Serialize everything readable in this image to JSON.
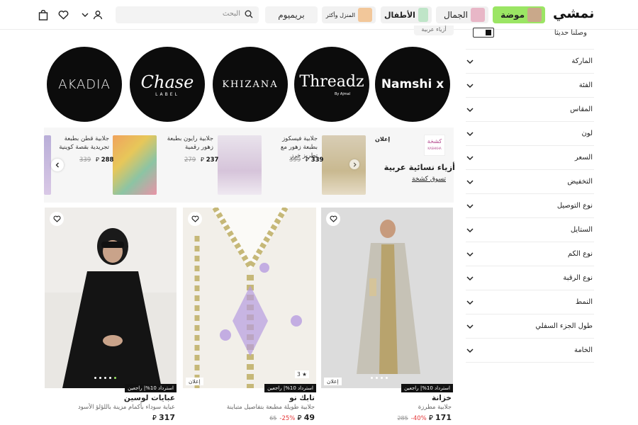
{
  "header": {
    "logo": "نمشي",
    "categories": [
      {
        "label": "موضة",
        "bg": "#9be564"
      },
      {
        "label": "الجمال",
        "bg": "#f1f1f1"
      },
      {
        "label": "الأطفال",
        "bg": "#f1f1f1"
      },
      {
        "label": "المنزل وأكثر",
        "bg": "#f1f1f1"
      }
    ],
    "premium": "بريميوم",
    "search_placeholder": "البحث"
  },
  "breadcrumb": "أزياء عربية",
  "sidebar": {
    "new_arrivals": "وصلنا حديثا",
    "filters": [
      "الماركة",
      "الفئة",
      "المقاس",
      "لون",
      "السعر",
      "التخفيض",
      "نوع التوصيل",
      "الستايل",
      "نوع الكم",
      "نوع الرقبة",
      "النمط",
      "طول الجزء السفلي",
      "الخامة"
    ]
  },
  "brands": [
    {
      "name": "Namshi x",
      "sub": ""
    },
    {
      "name": "Threadz",
      "sub": "By Ajmal"
    },
    {
      "name": "KHIZANA",
      "sub": ""
    },
    {
      "name": "Chase",
      "sub": "LABEL"
    },
    {
      "name": "AKADIA",
      "sub": ""
    }
  ],
  "ad_strip": {
    "tag": "إعلان",
    "brand_logo": "كشخة",
    "brand_logo_sub": "KASHKHA",
    "title": "أزياء نسائية عربية",
    "cta": "تسوق كشخة",
    "products": [
      {
        "title": "جلابية فيسكوز بطبعة زهور مع تطريز خرز",
        "price": "339",
        "old": "399"
      },
      {
        "title": "جلابية رايون بطبعة زهور رقمية",
        "price": "237",
        "old": "279"
      },
      {
        "title": "جلابية قطن بطبعة تجريدية بقصة كوينية",
        "price": "288",
        "old": "339"
      }
    ]
  },
  "products": [
    {
      "brand": "خزانة",
      "desc": "جلابية مطرزة",
      "price": "171",
      "old": "285",
      "discount": "-40%",
      "badge": "استرداد 10%| راجعين",
      "ad": "إعلان",
      "rating": ""
    },
    {
      "brand": "تابك نو",
      "desc": "جلابية طويلة مطبعة بتفاصيل متباينة",
      "price": "49",
      "old": "65",
      "discount": "-25%",
      "badge": "استرداد 10%| راجعين",
      "ad": "إعلان",
      "rating": "3 ★"
    },
    {
      "brand": "عبايات لوسين",
      "desc": "عباية سوداء بأكمام مزينة باللؤلؤ الأسود",
      "price": "317",
      "old": "",
      "discount": "",
      "badge": "استرداد 10%| راجعين",
      "ad": "",
      "rating": ""
    }
  ],
  "colors": {
    "accent": "#9be564",
    "discount": "#e5393a"
  }
}
